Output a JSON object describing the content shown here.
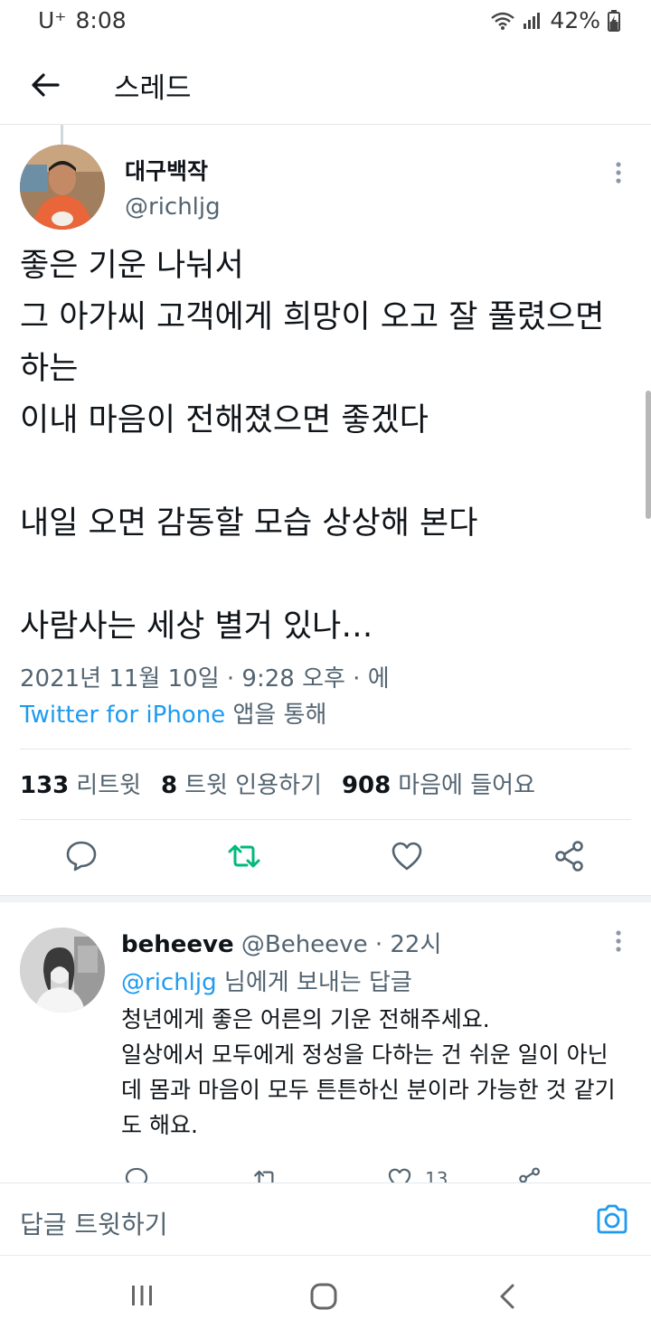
{
  "status_bar": {
    "carrier": "U⁺",
    "time": "8:08",
    "battery": "42%"
  },
  "header": {
    "title": "스레드"
  },
  "tweet": {
    "author_name": "대구백작",
    "author_handle": "@richljg",
    "text": "좋은 기운 나눠서\n그 아가씨 고객에게 희망이 오고 잘 풀렸으면 하는\n이내 마음이 전해졌으면 좋겠다\n\n내일 오면 감동할 모습 상상해 본다\n\n사람사는 세상 별거 있나…",
    "timestamp": "2021년 11월 10일 · 9:28 오후 · 에",
    "source_app": "Twitter for iPhone",
    "source_suffix": "앱을 통해",
    "stats": {
      "retweets": "133",
      "retweets_label": "리트윗",
      "quotes": "8",
      "quotes_label": "트윗 인용하기",
      "likes": "908",
      "likes_label": "마음에 들어요"
    }
  },
  "reply": {
    "author_name": "beheeve",
    "author_handle": "@Beheeve",
    "time": "· 22시",
    "reply_to_handle": "@richljg",
    "reply_to_suffix": "님에게 보내는 답글",
    "text": "청년에게 좋은 어른의 기운 전해주세요.\n일상에서 모두에게 정성을 다하는 건 쉬운 일이 아닌데 몸과 마음이 모두 튼튼하신 분이라 가능한 것 같기도 해요.",
    "like_count": "13"
  },
  "compose": {
    "placeholder": "답글 트윗하기"
  },
  "colors": {
    "link": "#1d9bf0",
    "retweet_green": "#00ba7c",
    "secondary_text": "#536471"
  }
}
